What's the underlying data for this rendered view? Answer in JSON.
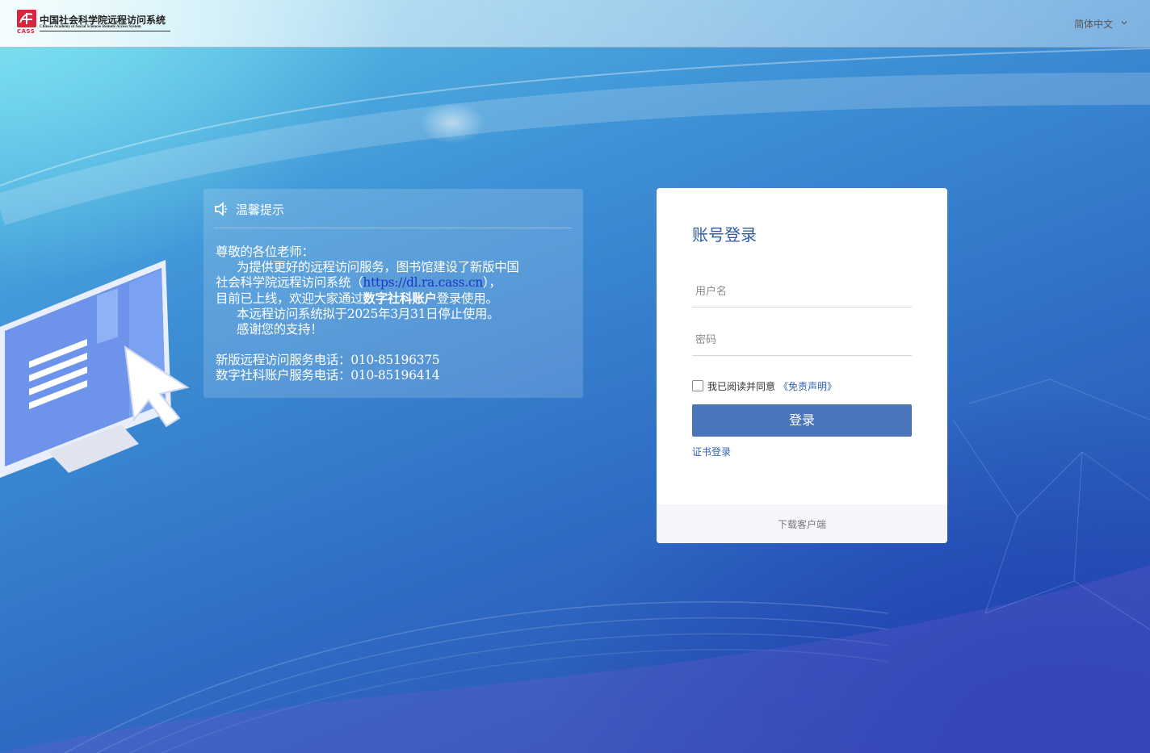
{
  "header": {
    "logo_abbr": "CASS",
    "logo_title_cn": "中国社会科学院远程访问系统",
    "logo_title_en": "Chinese Academy of Social Sciences Remote Access System",
    "language": "简体中文"
  },
  "notice": {
    "title": "温馨提示",
    "greeting": "尊敬的各位老师：",
    "line1": "为提供更好的远程访问服务，图书馆建设了新版中国",
    "line2_pre": "社会科学院远程访问系统（",
    "line2_link": "https://dl.ra.cass.cn",
    "line2_post": "），",
    "line3_pre": "目前已上线，欢迎大家通过",
    "line3_bold": "数字社科账户",
    "line3_post": "登录使用。",
    "line4": "本远程访问系统拟于2025年3月31日停止使用。",
    "line5": "感谢您的支持！",
    "phone1": "新版远程访问服务电话：010-85196375",
    "phone2": "数字社科账户服务电话：010-85196414"
  },
  "login": {
    "title": "账号登录",
    "username_placeholder": "用户名",
    "password_placeholder": "密码",
    "agree_text": "我已阅读并同意",
    "disclaimer_link": "《免责声明》",
    "login_button": "登录",
    "cert_login": "证书登录",
    "download_client": "下载客户端"
  },
  "colors": {
    "accent_button": "#4a75bb",
    "link": "#3563b7",
    "card_title": "#2f5aa6"
  }
}
